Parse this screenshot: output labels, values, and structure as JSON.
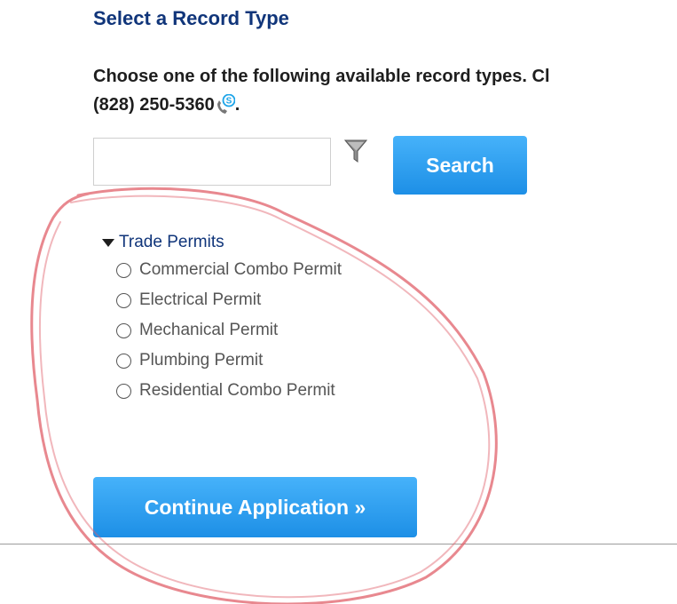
{
  "header": {
    "title": "Select a Record Type",
    "instructions_line1": "Choose one of the following available record types.  Cl",
    "phone": "(828) 250-5360",
    "phone_suffix": "."
  },
  "search": {
    "value": "",
    "placeholder": "",
    "button_label": "Search"
  },
  "tree": {
    "category_label": "Trade Permits",
    "expanded": true,
    "options": [
      {
        "label": "Commercial Combo Permit",
        "selected": false
      },
      {
        "label": "Electrical Permit",
        "selected": false
      },
      {
        "label": "Mechanical Permit",
        "selected": false
      },
      {
        "label": "Plumbing Permit",
        "selected": false
      },
      {
        "label": "Residential Combo Permit",
        "selected": false
      }
    ]
  },
  "actions": {
    "continue_label": "Continue Application »"
  },
  "icons": {
    "filter": "filter-icon",
    "skype": "skype-phone-icon",
    "expand": "triangle-down-icon"
  },
  "colors": {
    "title": "#10357a",
    "button": "#1d8fe6",
    "annotation": "#e0606a"
  }
}
